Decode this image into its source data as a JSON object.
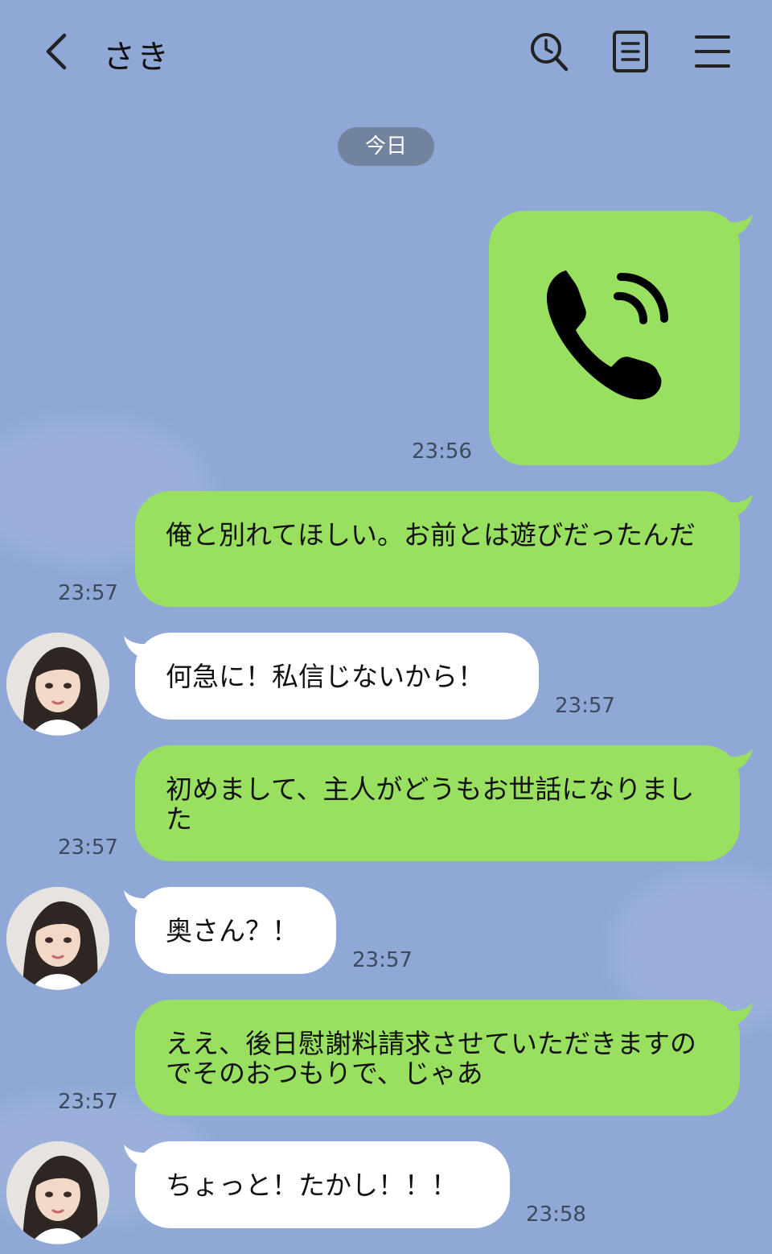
{
  "header": {
    "contact_name": "さき",
    "icons": [
      "back-chevron-icon",
      "search-icon",
      "notes-icon",
      "menu-icon"
    ]
  },
  "date_separator": "今日",
  "colors": {
    "background": "#8fa8d6",
    "sent_bubble": "#99e061",
    "received_bubble": "#ffffff",
    "date_pill": "#72839f"
  },
  "messages": [
    {
      "from": "me",
      "type": "call",
      "icon": "phone-call-icon",
      "time": "23:56"
    },
    {
      "from": "me",
      "type": "text",
      "text": "俺と別れてほしい。お前とは遊びだったんだ",
      "time": "23:57"
    },
    {
      "from": "さき",
      "type": "text",
      "text": "何急に！私信じないから！",
      "time": "23:57"
    },
    {
      "from": "me",
      "type": "text",
      "text": "初めまして、主人がどうもお世話になりました",
      "time": "23:57"
    },
    {
      "from": "さき",
      "type": "text",
      "text": "奥さん？！",
      "time": "23:57"
    },
    {
      "from": "me",
      "type": "text",
      "text": "ええ、後日慰謝料請求させていただきますのでそのおつもりで、じゃあ",
      "time": "23:57"
    },
    {
      "from": "さき",
      "type": "text",
      "text": "ちょっと！たかし！！！",
      "time": "23:58"
    }
  ]
}
